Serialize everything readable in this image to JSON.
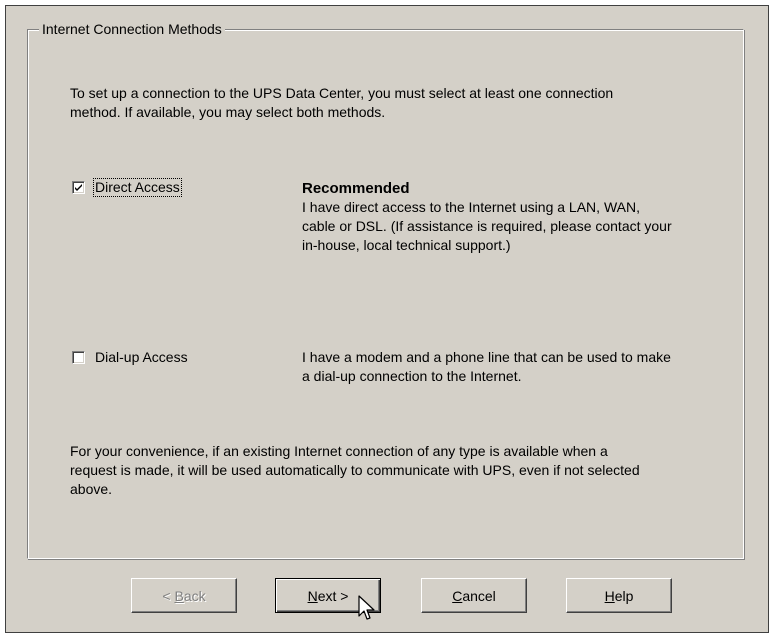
{
  "group": {
    "title": "Internet Connection Methods",
    "intro_line1": "To set up a connection to the UPS Data Center, you must select at least one connection",
    "intro_line2": "method. If available, you may select both methods."
  },
  "direct_access": {
    "label": "Direct Access",
    "checked": true,
    "heading": "Recommended",
    "desc_line1": "I have direct access to the Internet using a LAN, WAN,",
    "desc_line2": "cable or DSL. (If assistance is required, please contact your",
    "desc_line3": "in-house, local technical support.)"
  },
  "dialup_access": {
    "label": "Dial-up Access",
    "checked": false,
    "desc_line1": "I have a modem and a phone line that can be used to make",
    "desc_line2": "a dial-up connection to the Internet."
  },
  "footer_note": {
    "line1": "For your convenience, if an existing Internet connection of any type is available when a",
    "line2": "request is made, it will be used automatically to communicate with UPS, even if not selected",
    "line3": "above."
  },
  "buttons": {
    "back_pre": "< ",
    "back_mnemonic": "B",
    "back_post": "ack",
    "next_mnemonic": "N",
    "next_post": "ext >",
    "cancel_mnemonic": "C",
    "cancel_post": "ancel",
    "help_mnemonic": "H",
    "help_post": "elp"
  }
}
